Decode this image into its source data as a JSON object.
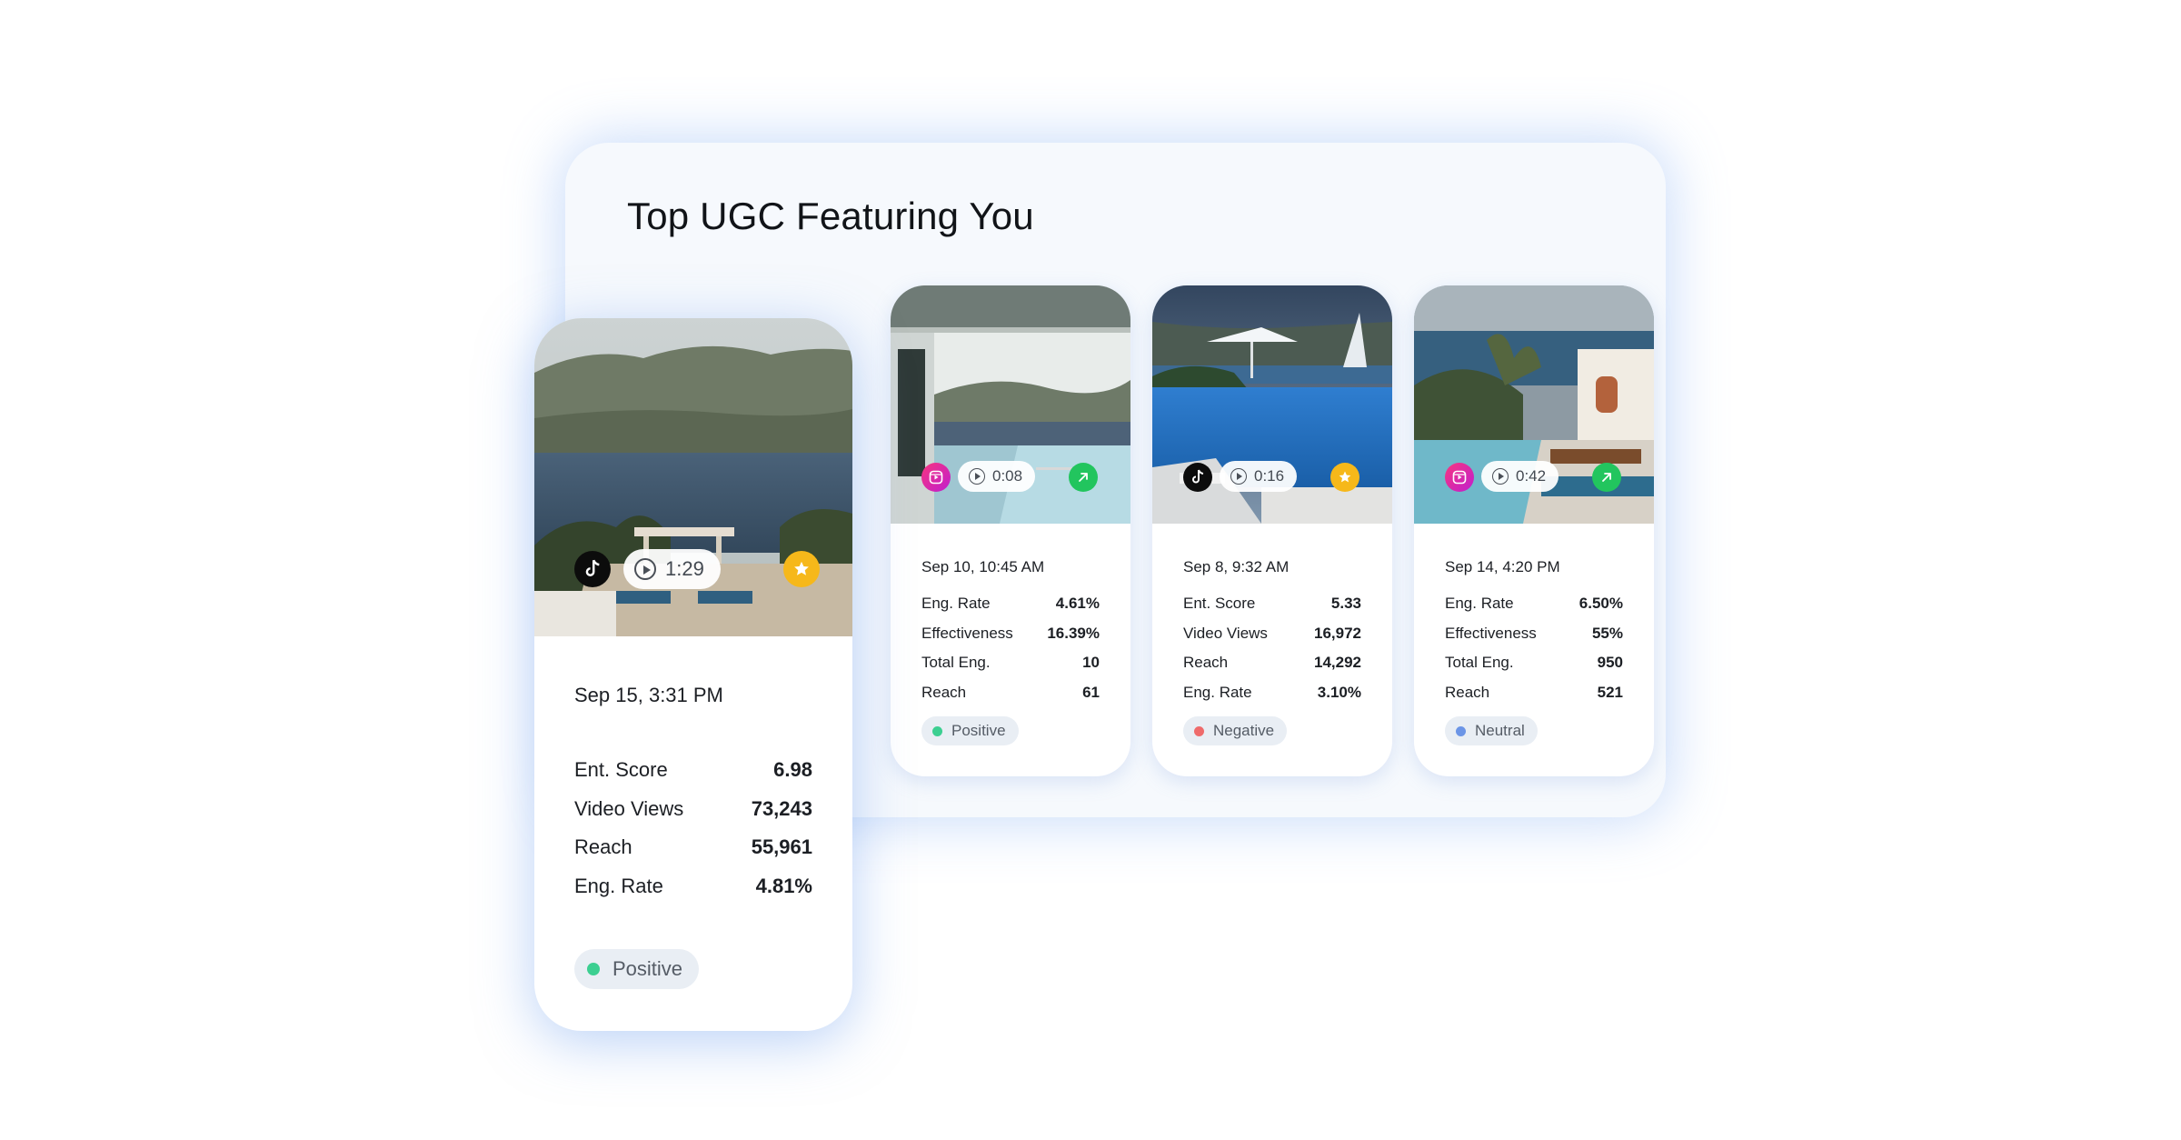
{
  "title": "Top UGC Featuring You",
  "colors": {
    "positive": "#3ccf91",
    "negative": "#ef6b6b",
    "neutral": "#6c95e6",
    "star": "#f6b81a",
    "trend": "#22c55e",
    "panel_bg": "#f6f9fd"
  },
  "featured": {
    "platform": "tiktok-icon",
    "duration": "1:29",
    "status_icon": "star-icon",
    "date": "Sep 15, 3:31 PM",
    "metrics": [
      {
        "label": "Ent. Score",
        "value": "6.98"
      },
      {
        "label": "Video Views",
        "value": "73,243"
      },
      {
        "label": "Reach",
        "value": "55,961"
      },
      {
        "label": "Eng. Rate",
        "value": "4.81%"
      }
    ],
    "sentiment": "Positive"
  },
  "cards": [
    {
      "platform": "instagram-reels-icon",
      "duration": "0:08",
      "status_icon": "trend-arrow-icon",
      "date": "Sep 10, 10:45 AM",
      "metrics": [
        {
          "label": "Eng. Rate",
          "value": "4.61%"
        },
        {
          "label": "Effectiveness",
          "value": "16.39%"
        },
        {
          "label": "Total Eng.",
          "value": "10"
        },
        {
          "label": "Reach",
          "value": "61"
        }
      ],
      "sentiment": "Positive"
    },
    {
      "platform": "tiktok-icon",
      "duration": "0:16",
      "status_icon": "star-icon",
      "date": "Sep 8, 9:32 AM",
      "metrics": [
        {
          "label": "Ent. Score",
          "value": "5.33"
        },
        {
          "label": "Video Views",
          "value": "16,972"
        },
        {
          "label": "Reach",
          "value": "14,292"
        },
        {
          "label": "Eng. Rate",
          "value": "3.10%"
        }
      ],
      "sentiment": "Negative"
    },
    {
      "platform": "instagram-reels-icon",
      "duration": "0:42",
      "status_icon": "trend-arrow-icon",
      "date": "Sep 14, 4:20 PM",
      "metrics": [
        {
          "label": "Eng. Rate",
          "value": "6.50%"
        },
        {
          "label": "Effectiveness",
          "value": "55%"
        },
        {
          "label": "Total Eng.",
          "value": "950"
        },
        {
          "label": "Reach",
          "value": "521"
        }
      ],
      "sentiment": "Neutral"
    }
  ]
}
